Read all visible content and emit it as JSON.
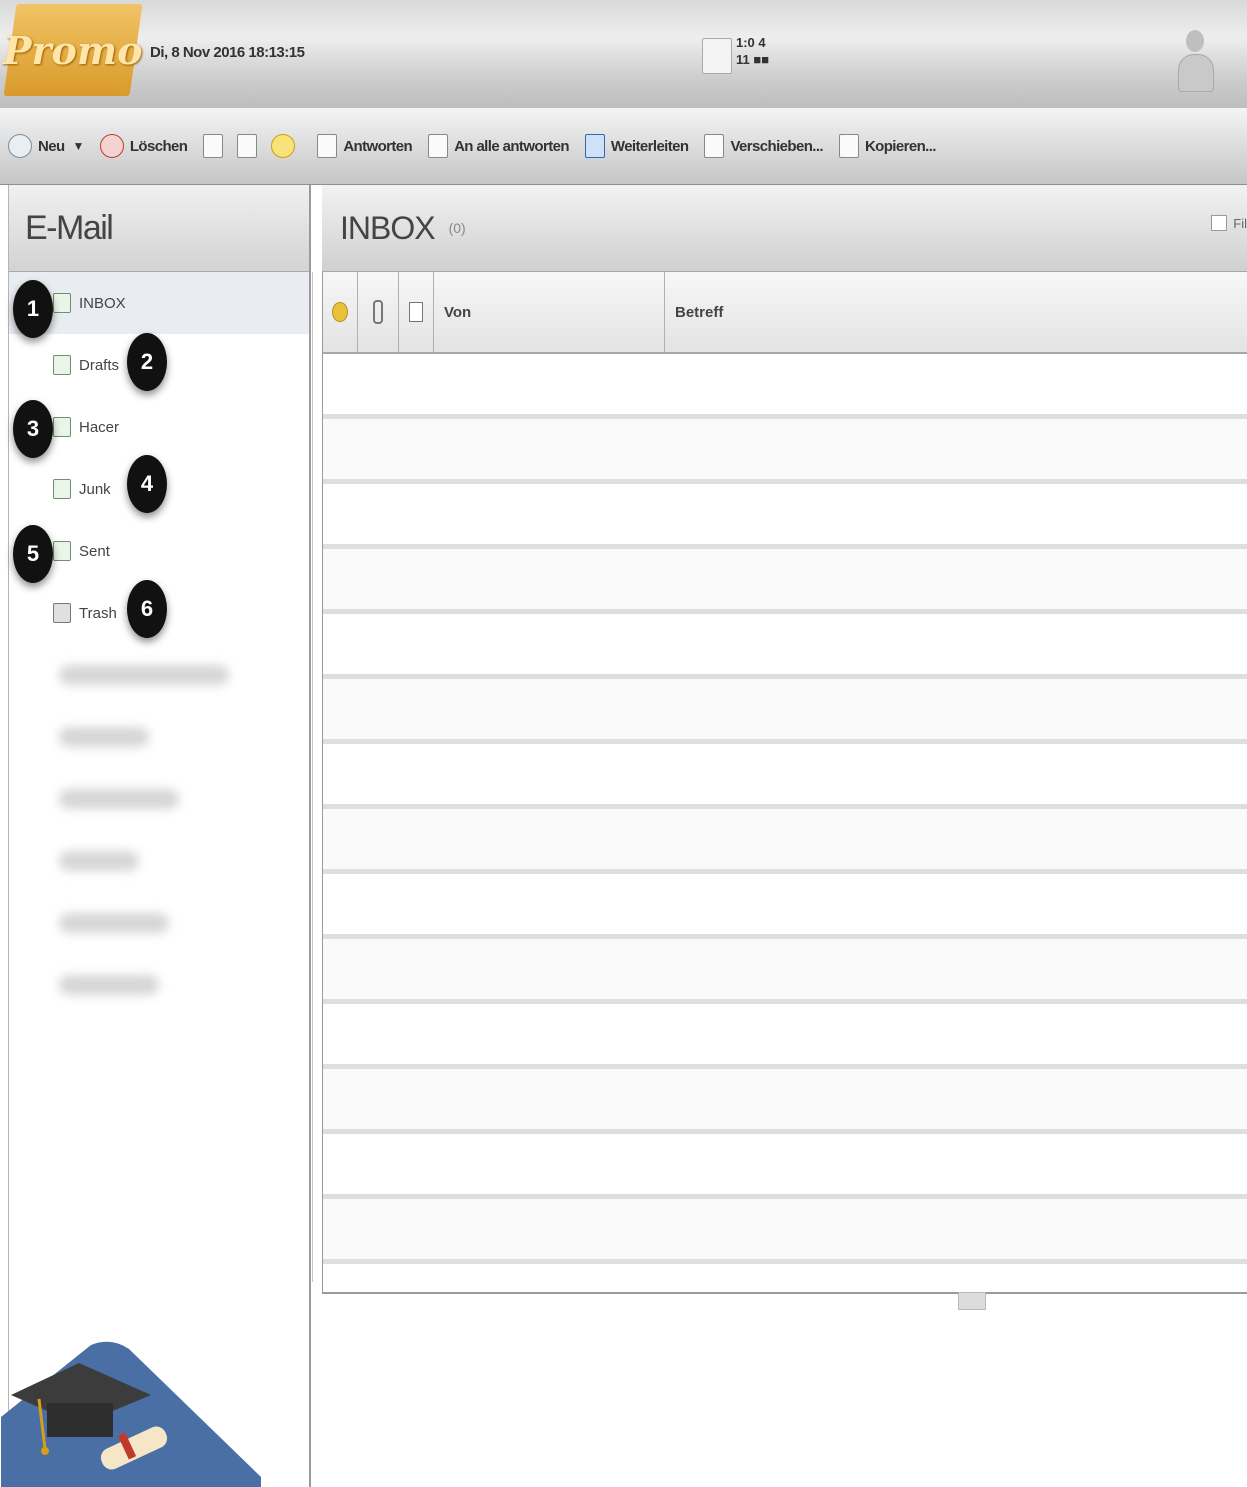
{
  "header": {
    "logo_text": "Promo",
    "datetime": "Di, 8 Nov 2016 18:13:15",
    "status_top": "1:0   4",
    "status_bottom": "11  ■■"
  },
  "toolbar": {
    "new_label": "Neu",
    "delete_label": "Löschen",
    "reply_label": "Antworten",
    "reply_all_label": "An alle antworten",
    "forward_label": "Weiterleiten",
    "move_label": "Verschieben...",
    "copy_label": "Kopieren..."
  },
  "sidebar": {
    "title": "E-Mail",
    "folders": [
      {
        "label": "INBOX",
        "badge": "1"
      },
      {
        "label": "Drafts",
        "badge": "2"
      },
      {
        "label": "Hacer",
        "badge": "3"
      },
      {
        "label": "Junk",
        "badge": "4"
      },
      {
        "label": "Sent",
        "badge": "5"
      },
      {
        "label": "Trash",
        "badge": "6"
      }
    ]
  },
  "main": {
    "title": "INBOX",
    "title_count": "(0)",
    "filter_label": "Fil"
  },
  "columns": {
    "from": "Von",
    "subject": "Betreff"
  },
  "colors": {
    "logo": "#d99a2a",
    "badge": "#111111",
    "grad_badge": "#4a6fa5"
  },
  "icons": [
    "new-icon",
    "delete-icon",
    "reply-icon",
    "reply-all-icon",
    "forward-icon",
    "move-icon",
    "copy-icon",
    "folder-icon",
    "trash-icon",
    "user-icon",
    "graduation-cap-icon"
  ]
}
